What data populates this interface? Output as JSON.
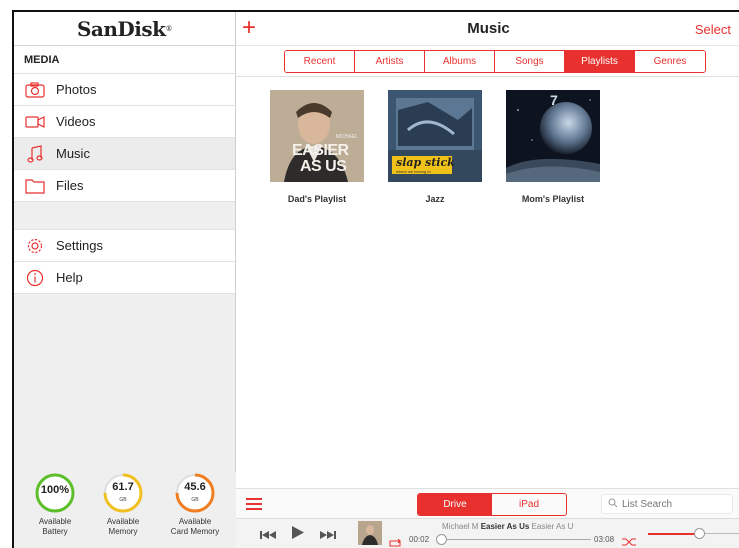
{
  "brand": {
    "name": "SanDisk",
    "mark": "®"
  },
  "sidebar": {
    "section_media": "MEDIA",
    "media_items": [
      {
        "label": "Photos",
        "icon": "camera-icon"
      },
      {
        "label": "Videos",
        "icon": "video-camera-icon"
      },
      {
        "label": "Music",
        "icon": "music-note-icon"
      },
      {
        "label": "Files",
        "icon": "folder-icon"
      }
    ],
    "other_items": [
      {
        "label": "Settings",
        "icon": "gear-icon"
      },
      {
        "label": "Help",
        "icon": "info-icon"
      }
    ],
    "gauges": [
      {
        "value": "100%",
        "unit": "",
        "caption_1": "Available",
        "caption_2": "Battery",
        "level": 1.0
      },
      {
        "value": "61.7",
        "unit": "GB",
        "caption_1": "Available",
        "caption_2": "Memory",
        "level": 0.75
      },
      {
        "value": "45.6",
        "unit": "GB",
        "caption_1": "Available",
        "caption_2": "Card Memory",
        "level": 0.75
      }
    ]
  },
  "header": {
    "add": "+",
    "title": "Music",
    "select_label": "Select"
  },
  "tabs": [
    "Recent",
    "Artists",
    "Albums",
    "Songs",
    "Playlists",
    "Genres"
  ],
  "active_tab": "Playlists",
  "playlists": [
    {
      "name": "Dad's Playlist",
      "cover_text_1": "EASIER",
      "cover_text_2": "AS US",
      "cover_text_3": "MICHAEL"
    },
    {
      "name": "Jazz",
      "cover_text_1": "slap stick",
      "cover_text_2": "where we belong to"
    },
    {
      "name": "Mom's Playlist",
      "cover_text_1": "7"
    }
  ],
  "toolbar": {
    "segments": [
      "Drive",
      "iPad"
    ],
    "active_segment": "Drive",
    "search_placeholder": "List Search"
  },
  "player": {
    "artist": "Michael M",
    "song": "Easier As Us",
    "song_scroll": "Easier As U",
    "elapsed": "00:02",
    "duration": "03:08",
    "progress": 0.01,
    "volume": 0.55
  },
  "colors": {
    "accent": "#e8312e",
    "gauge_green": "#5cbf2a",
    "gauge_yellow": "#f0c020",
    "gauge_orange": "#f07e20"
  }
}
